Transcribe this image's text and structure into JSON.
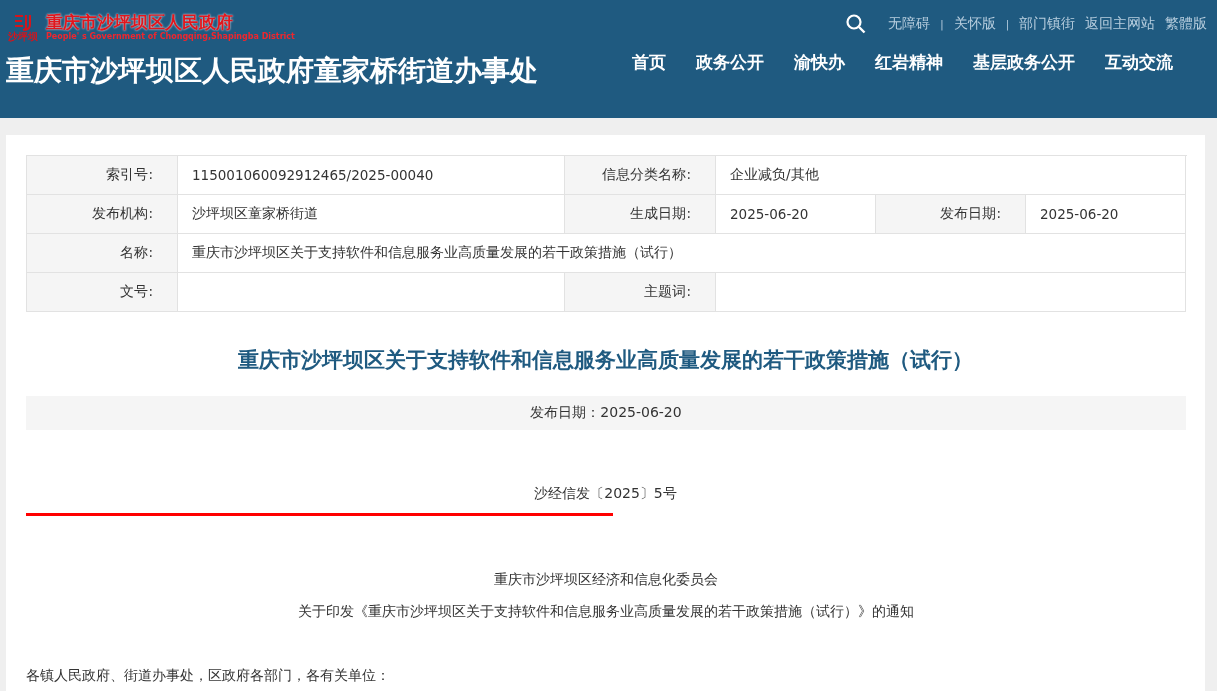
{
  "header": {
    "logo_mark": "沙坪坝",
    "logo_title": "重庆市沙坪坝区人民政府",
    "logo_subtitle": "People' s Government of Chongqing,Shapingba District",
    "site_title": "重庆市沙坪坝区人民政府童家桥街道办事处",
    "top_links": [
      {
        "kind": "link",
        "label": "无障碍"
      },
      {
        "kind": "separator",
        "label": "|"
      },
      {
        "kind": "link",
        "label": "关怀版"
      },
      {
        "kind": "separator",
        "label": "|"
      },
      {
        "kind": "link",
        "label": "部门镇街"
      },
      {
        "kind": "link",
        "label": "返回主网站"
      },
      {
        "kind": "link",
        "label": "繁體版"
      }
    ],
    "nav": [
      "首页",
      "政务公开",
      "渝快办",
      "红岩精神",
      "基层政务公开",
      "互动交流"
    ]
  },
  "info_table": {
    "rows": [
      [
        {
          "kind": "label",
          "text": "索引号:"
        },
        {
          "kind": "value",
          "text": "115001060092912465/2025-00040"
        },
        {
          "kind": "label",
          "text": "信息分类名称:"
        },
        {
          "kind": "value",
          "text": "企业减负/其他"
        }
      ],
      [
        {
          "kind": "label",
          "text": "发布机构:"
        },
        {
          "kind": "value",
          "text": "沙坪坝区童家桥街道"
        },
        {
          "kind": "label",
          "text": "生成日期:"
        },
        {
          "kind": "value",
          "text": "2025-06-20"
        },
        {
          "kind": "label",
          "text": "发布日期:"
        },
        {
          "kind": "value",
          "text": "2025-06-20"
        }
      ],
      [
        {
          "kind": "label",
          "text": "名称:"
        },
        {
          "kind": "value",
          "text": "重庆市沙坪坝区关于支持软件和信息服务业高质量发展的若干政策措施（试行）"
        }
      ],
      [
        {
          "kind": "label",
          "text": "文号:"
        },
        {
          "kind": "value"
        },
        {
          "kind": "label",
          "text": "主题词:"
        },
        {
          "kind": "value"
        }
      ]
    ]
  },
  "article": {
    "title": "重庆市沙坪坝区关于支持软件和信息服务业高质量发展的若干政策措施（试行）",
    "publish_date": "发布日期：2025-06-20",
    "doc_number": "沙经信发〔2025〕5号",
    "issuer": "重庆市沙坪坝区经济和信息化委员会",
    "notice_title": "关于印发《重庆市沙坪坝区关于支持软件和信息服务业高质量发展的若干政策措施（试行）》的通知",
    "salutation": "各镇人民政府、街道办事处，区政府各部门，各有关单位："
  }
}
